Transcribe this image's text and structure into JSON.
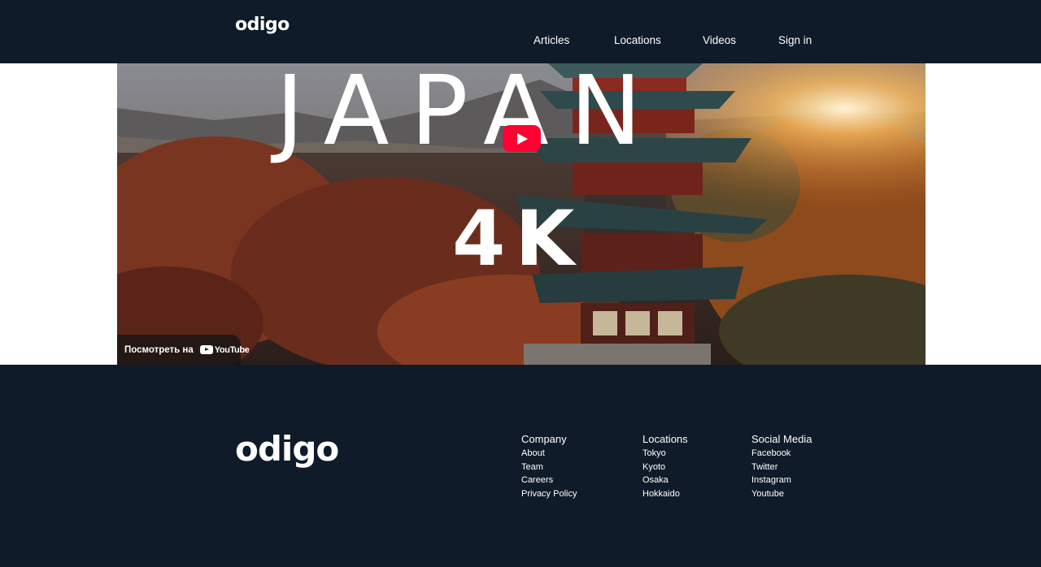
{
  "header": {
    "logo": "odigo",
    "nav": [
      "Articles",
      "Locations",
      "Videos",
      "Sign in"
    ]
  },
  "video": {
    "title": "JAPAN",
    "subtitle": "4K",
    "watch_on_label": "Посмотреть на",
    "platform": "YouTube",
    "play_icon": "play-icon",
    "colors": {
      "play_button": "#ff0033"
    }
  },
  "footer": {
    "logo": "odigo",
    "columns": [
      {
        "heading": "Company",
        "links": [
          "About",
          "Team",
          "Careers",
          "Privacy Policy"
        ]
      },
      {
        "heading": "Locations",
        "links": [
          "Tokyo",
          "Kyoto",
          "Osaka",
          "Hokkaido"
        ]
      },
      {
        "heading": "Social Media",
        "links": [
          "Facebook",
          "Twitter",
          "Instagram",
          "Youtube"
        ]
      }
    ]
  },
  "colors": {
    "navy": "#0f1b28",
    "background": "#ffffff"
  }
}
